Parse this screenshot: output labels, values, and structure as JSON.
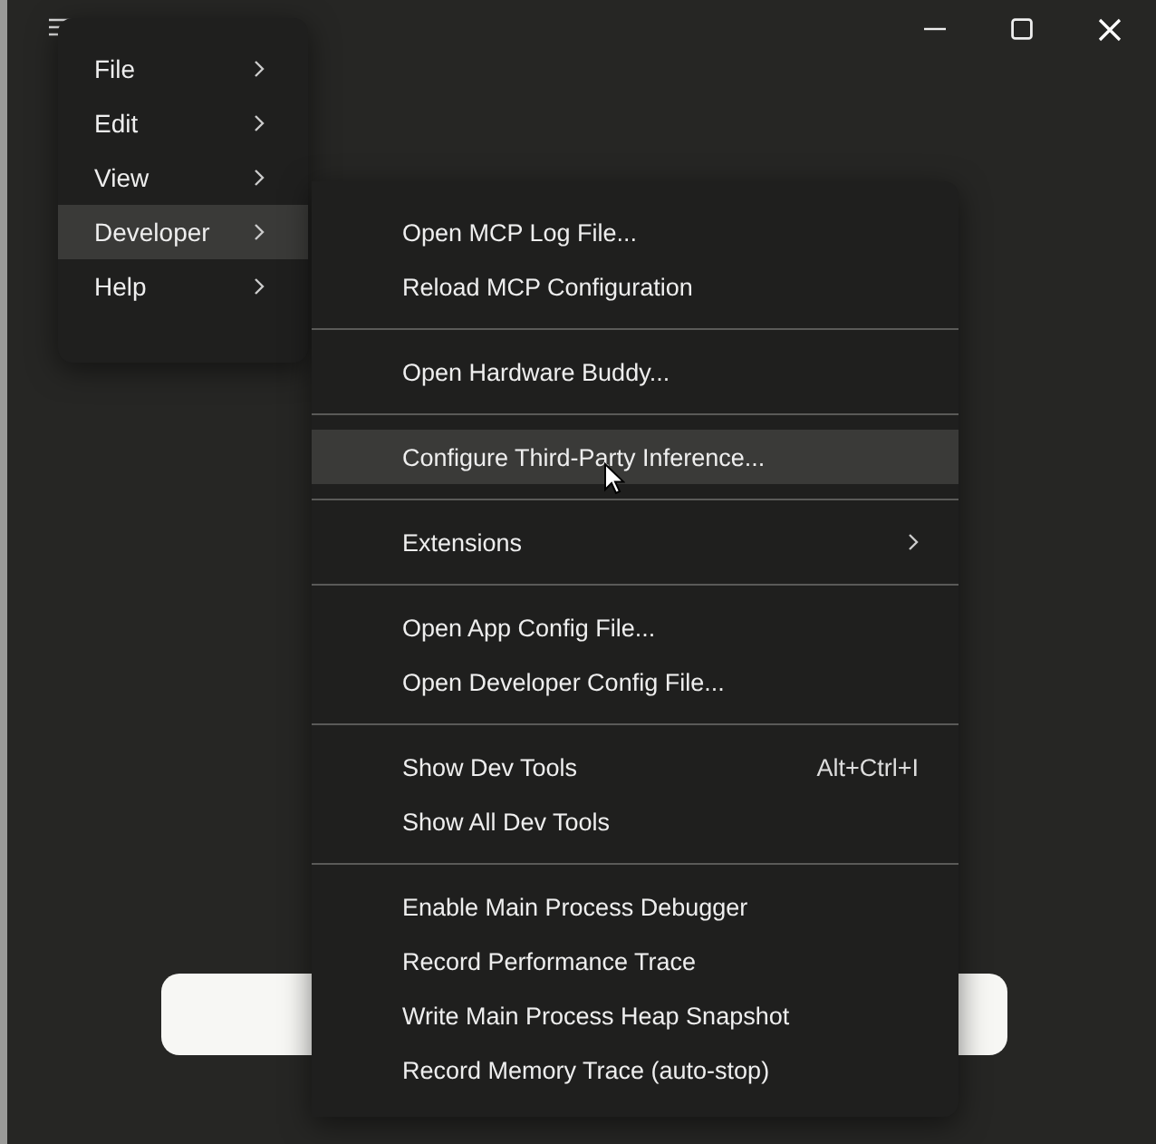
{
  "main_menu": {
    "items": [
      {
        "label": "File",
        "selected": false
      },
      {
        "label": "Edit",
        "selected": false
      },
      {
        "label": "View",
        "selected": false
      },
      {
        "label": "Developer",
        "selected": true
      },
      {
        "label": "Help",
        "selected": false
      }
    ]
  },
  "developer_menu": {
    "groups": [
      {
        "items": [
          {
            "kind": "action",
            "label": "Open MCP Log File...",
            "selected": false
          },
          {
            "kind": "action",
            "label": "Reload MCP Configuration",
            "selected": false
          }
        ]
      },
      {
        "items": [
          {
            "kind": "action",
            "label": "Open Hardware Buddy...",
            "selected": false
          }
        ]
      },
      {
        "items": [
          {
            "kind": "action",
            "label": "Configure Third-Party Inference...",
            "selected": true
          }
        ]
      },
      {
        "items": [
          {
            "kind": "submenu",
            "label": "Extensions",
            "selected": false
          }
        ]
      },
      {
        "items": [
          {
            "kind": "action",
            "label": "Open App Config File...",
            "selected": false
          },
          {
            "kind": "action",
            "label": "Open Developer Config File...",
            "selected": false
          }
        ]
      },
      {
        "items": [
          {
            "kind": "action",
            "label": "Show Dev Tools",
            "shortcut": "Alt+Ctrl+I",
            "selected": false
          },
          {
            "kind": "action",
            "label": "Show All Dev Tools",
            "selected": false
          }
        ]
      },
      {
        "items": [
          {
            "kind": "action",
            "label": "Enable Main Process Debugger",
            "selected": false
          },
          {
            "kind": "action",
            "label": "Record Performance Trace",
            "selected": false
          },
          {
            "kind": "action",
            "label": "Write Main Process Heap Snapshot",
            "selected": false
          },
          {
            "kind": "action",
            "label": "Record Memory Trace (auto-stop)",
            "selected": false
          }
        ]
      }
    ]
  }
}
